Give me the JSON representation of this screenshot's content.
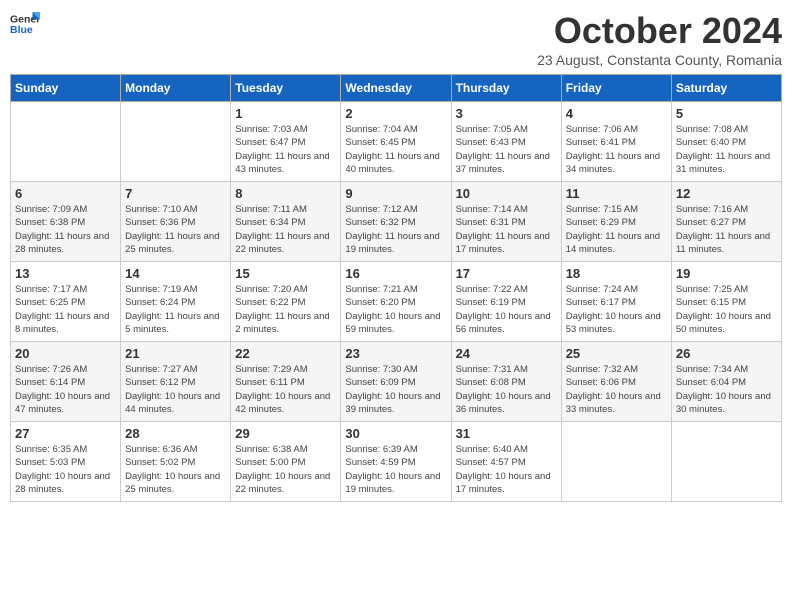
{
  "header": {
    "logo_line1": "General",
    "logo_line2": "Blue",
    "month_title": "October 2024",
    "subtitle": "23 August, Constanta County, Romania"
  },
  "days_of_week": [
    "Sunday",
    "Monday",
    "Tuesday",
    "Wednesday",
    "Thursday",
    "Friday",
    "Saturday"
  ],
  "weeks": [
    [
      {
        "day": "",
        "sunrise": "",
        "sunset": "",
        "daylight": ""
      },
      {
        "day": "",
        "sunrise": "",
        "sunset": "",
        "daylight": ""
      },
      {
        "day": "1",
        "sunrise": "Sunrise: 7:03 AM",
        "sunset": "Sunset: 6:47 PM",
        "daylight": "Daylight: 11 hours and 43 minutes."
      },
      {
        "day": "2",
        "sunrise": "Sunrise: 7:04 AM",
        "sunset": "Sunset: 6:45 PM",
        "daylight": "Daylight: 11 hours and 40 minutes."
      },
      {
        "day": "3",
        "sunrise": "Sunrise: 7:05 AM",
        "sunset": "Sunset: 6:43 PM",
        "daylight": "Daylight: 11 hours and 37 minutes."
      },
      {
        "day": "4",
        "sunrise": "Sunrise: 7:06 AM",
        "sunset": "Sunset: 6:41 PM",
        "daylight": "Daylight: 11 hours and 34 minutes."
      },
      {
        "day": "5",
        "sunrise": "Sunrise: 7:08 AM",
        "sunset": "Sunset: 6:40 PM",
        "daylight": "Daylight: 11 hours and 31 minutes."
      }
    ],
    [
      {
        "day": "6",
        "sunrise": "Sunrise: 7:09 AM",
        "sunset": "Sunset: 6:38 PM",
        "daylight": "Daylight: 11 hours and 28 minutes."
      },
      {
        "day": "7",
        "sunrise": "Sunrise: 7:10 AM",
        "sunset": "Sunset: 6:36 PM",
        "daylight": "Daylight: 11 hours and 25 minutes."
      },
      {
        "day": "8",
        "sunrise": "Sunrise: 7:11 AM",
        "sunset": "Sunset: 6:34 PM",
        "daylight": "Daylight: 11 hours and 22 minutes."
      },
      {
        "day": "9",
        "sunrise": "Sunrise: 7:12 AM",
        "sunset": "Sunset: 6:32 PM",
        "daylight": "Daylight: 11 hours and 19 minutes."
      },
      {
        "day": "10",
        "sunrise": "Sunrise: 7:14 AM",
        "sunset": "Sunset: 6:31 PM",
        "daylight": "Daylight: 11 hours and 17 minutes."
      },
      {
        "day": "11",
        "sunrise": "Sunrise: 7:15 AM",
        "sunset": "Sunset: 6:29 PM",
        "daylight": "Daylight: 11 hours and 14 minutes."
      },
      {
        "day": "12",
        "sunrise": "Sunrise: 7:16 AM",
        "sunset": "Sunset: 6:27 PM",
        "daylight": "Daylight: 11 hours and 11 minutes."
      }
    ],
    [
      {
        "day": "13",
        "sunrise": "Sunrise: 7:17 AM",
        "sunset": "Sunset: 6:25 PM",
        "daylight": "Daylight: 11 hours and 8 minutes."
      },
      {
        "day": "14",
        "sunrise": "Sunrise: 7:19 AM",
        "sunset": "Sunset: 6:24 PM",
        "daylight": "Daylight: 11 hours and 5 minutes."
      },
      {
        "day": "15",
        "sunrise": "Sunrise: 7:20 AM",
        "sunset": "Sunset: 6:22 PM",
        "daylight": "Daylight: 11 hours and 2 minutes."
      },
      {
        "day": "16",
        "sunrise": "Sunrise: 7:21 AM",
        "sunset": "Sunset: 6:20 PM",
        "daylight": "Daylight: 10 hours and 59 minutes."
      },
      {
        "day": "17",
        "sunrise": "Sunrise: 7:22 AM",
        "sunset": "Sunset: 6:19 PM",
        "daylight": "Daylight: 10 hours and 56 minutes."
      },
      {
        "day": "18",
        "sunrise": "Sunrise: 7:24 AM",
        "sunset": "Sunset: 6:17 PM",
        "daylight": "Daylight: 10 hours and 53 minutes."
      },
      {
        "day": "19",
        "sunrise": "Sunrise: 7:25 AM",
        "sunset": "Sunset: 6:15 PM",
        "daylight": "Daylight: 10 hours and 50 minutes."
      }
    ],
    [
      {
        "day": "20",
        "sunrise": "Sunrise: 7:26 AM",
        "sunset": "Sunset: 6:14 PM",
        "daylight": "Daylight: 10 hours and 47 minutes."
      },
      {
        "day": "21",
        "sunrise": "Sunrise: 7:27 AM",
        "sunset": "Sunset: 6:12 PM",
        "daylight": "Daylight: 10 hours and 44 minutes."
      },
      {
        "day": "22",
        "sunrise": "Sunrise: 7:29 AM",
        "sunset": "Sunset: 6:11 PM",
        "daylight": "Daylight: 10 hours and 42 minutes."
      },
      {
        "day": "23",
        "sunrise": "Sunrise: 7:30 AM",
        "sunset": "Sunset: 6:09 PM",
        "daylight": "Daylight: 10 hours and 39 minutes."
      },
      {
        "day": "24",
        "sunrise": "Sunrise: 7:31 AM",
        "sunset": "Sunset: 6:08 PM",
        "daylight": "Daylight: 10 hours and 36 minutes."
      },
      {
        "day": "25",
        "sunrise": "Sunrise: 7:32 AM",
        "sunset": "Sunset: 6:06 PM",
        "daylight": "Daylight: 10 hours and 33 minutes."
      },
      {
        "day": "26",
        "sunrise": "Sunrise: 7:34 AM",
        "sunset": "Sunset: 6:04 PM",
        "daylight": "Daylight: 10 hours and 30 minutes."
      }
    ],
    [
      {
        "day": "27",
        "sunrise": "Sunrise: 6:35 AM",
        "sunset": "Sunset: 5:03 PM",
        "daylight": "Daylight: 10 hours and 28 minutes."
      },
      {
        "day": "28",
        "sunrise": "Sunrise: 6:36 AM",
        "sunset": "Sunset: 5:02 PM",
        "daylight": "Daylight: 10 hours and 25 minutes."
      },
      {
        "day": "29",
        "sunrise": "Sunrise: 6:38 AM",
        "sunset": "Sunset: 5:00 PM",
        "daylight": "Daylight: 10 hours and 22 minutes."
      },
      {
        "day": "30",
        "sunrise": "Sunrise: 6:39 AM",
        "sunset": "Sunset: 4:59 PM",
        "daylight": "Daylight: 10 hours and 19 minutes."
      },
      {
        "day": "31",
        "sunrise": "Sunrise: 6:40 AM",
        "sunset": "Sunset: 4:57 PM",
        "daylight": "Daylight: 10 hours and 17 minutes."
      },
      {
        "day": "",
        "sunrise": "",
        "sunset": "",
        "daylight": ""
      },
      {
        "day": "",
        "sunrise": "",
        "sunset": "",
        "daylight": ""
      }
    ]
  ]
}
